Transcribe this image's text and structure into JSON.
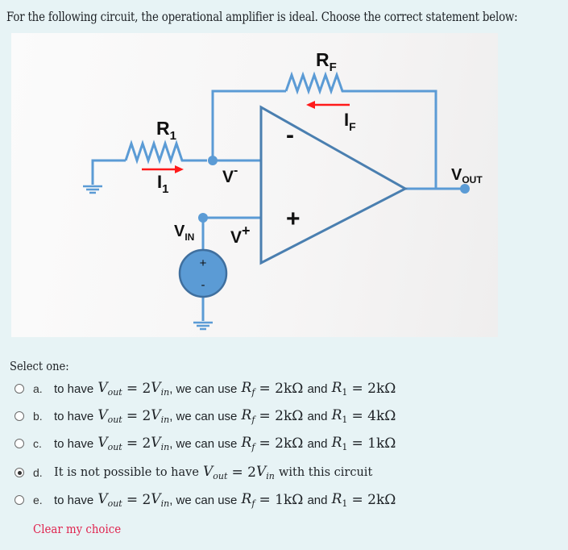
{
  "question": {
    "text": "For the following circuit, the operational amplifier is ideal. Choose the correct statement below:"
  },
  "circuit": {
    "labels": {
      "r1": "R",
      "r1_sub": "1",
      "rf": "R",
      "rf_sub": "F",
      "i1": "I",
      "i1_sub": "1",
      "if": "I",
      "if_sub": "F",
      "v_minus": "V",
      "v_minus_sup": "-",
      "v_plus": "V",
      "v_plus_sup": "+",
      "vin": "V",
      "vin_sub": "IN",
      "vout": "V",
      "vout_sub": "OUT",
      "opamp_minus": "-",
      "opamp_plus": "+",
      "source_plus": "+",
      "source_minus": "-"
    },
    "colors": {
      "wire": "#5b9bd5",
      "opamp_outline": "#4a7fb0",
      "current_arrow": "#ff1a1a",
      "source_fill": "#5b9bd5"
    }
  },
  "answers": {
    "prompt": "Select one:",
    "options": [
      {
        "letter": "a.",
        "selected": false,
        "prefix": "to have",
        "vout": "V",
        "vout_sub": "out",
        "eq": "= 2",
        "vin": "V",
        "vin_sub": "in",
        "mid": ", we can use",
        "rf": "R",
        "rf_sub": "f",
        "rf_val": "= 2kΩ",
        "and": "and",
        "r1": "R",
        "r1_sub": "1",
        "r1_val": "= 2kΩ"
      },
      {
        "letter": "b.",
        "selected": false,
        "prefix": "to have",
        "vout": "V",
        "vout_sub": "out",
        "eq": "= 2",
        "vin": "V",
        "vin_sub": "in",
        "mid": ", we can use",
        "rf": "R",
        "rf_sub": "f",
        "rf_val": "= 2kΩ",
        "and": "and",
        "r1": "R",
        "r1_sub": "1",
        "r1_val": "= 4kΩ"
      },
      {
        "letter": "c.",
        "selected": false,
        "prefix": "to have",
        "vout": "V",
        "vout_sub": "out",
        "eq": "= 2",
        "vin": "V",
        "vin_sub": "in",
        "mid": ", we can use",
        "rf": "R",
        "rf_sub": "f",
        "rf_val": "= 2kΩ",
        "and": "and",
        "r1": "R",
        "r1_sub": "1",
        "r1_val": "= 1kΩ"
      },
      {
        "letter": "d.",
        "selected": true,
        "prefix": "It is not possible to have",
        "vout": "V",
        "vout_sub": "out",
        "eq": "= 2",
        "vin": "V",
        "vin_sub": "in",
        "suffix": "with this circuit"
      },
      {
        "letter": "e.",
        "selected": false,
        "prefix": "to have",
        "vout": "V",
        "vout_sub": "out",
        "eq": "= 2",
        "vin": "V",
        "vin_sub": "in",
        "mid": ", we can use",
        "rf": "R",
        "rf_sub": "f",
        "rf_val": "= 1kΩ",
        "and": "and",
        "r1": "R",
        "r1_sub": "1",
        "r1_val": "= 2kΩ"
      }
    ],
    "clear_label": "Clear my choice"
  }
}
